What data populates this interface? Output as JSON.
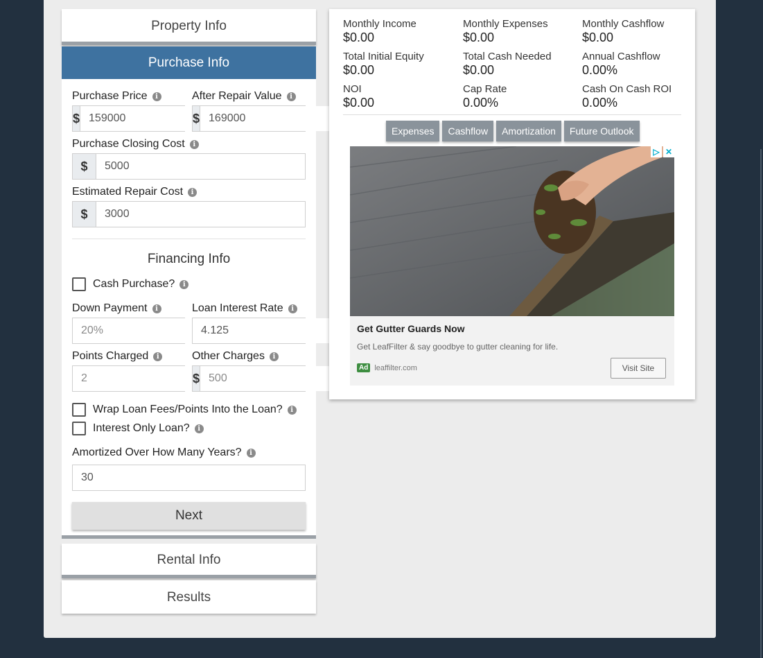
{
  "sections": {
    "property_info": "Property Info",
    "purchase_info": "Purchase Info",
    "rental_info": "Rental Info",
    "results": "Results"
  },
  "purchase": {
    "purchase_price": {
      "label": "Purchase Price",
      "prefix": "$",
      "value": "159000"
    },
    "after_repair_value": {
      "label": "After Repair Value",
      "prefix": "$",
      "value": "169000"
    },
    "closing_cost": {
      "label": "Purchase Closing Cost",
      "prefix": "$",
      "value": "5000"
    },
    "repair_cost": {
      "label": "Estimated Repair Cost",
      "prefix": "$",
      "value": "3000"
    }
  },
  "financing": {
    "title": "Financing Info",
    "cash_purchase": "Cash Purchase?",
    "down_payment": {
      "label": "Down Payment",
      "placeholder": "20%",
      "suffix": "%"
    },
    "interest_rate": {
      "label": "Loan Interest Rate",
      "value": "4.125",
      "suffix": "%"
    },
    "points": {
      "label": "Points Charged",
      "placeholder": "2"
    },
    "other_charges": {
      "label": "Other Charges",
      "prefix": "$",
      "placeholder": "500"
    },
    "wrap_fees": "Wrap Loan Fees/Points Into the Loan?",
    "interest_only": "Interest Only Loan?",
    "amortized": {
      "label": "Amortized Over How Many Years?",
      "value": "30"
    },
    "next": "Next"
  },
  "summary": {
    "monthly_income": {
      "label": "Monthly Income",
      "value": "$0.00"
    },
    "monthly_expenses": {
      "label": "Monthly Expenses",
      "value": "$0.00"
    },
    "monthly_cashflow": {
      "label": "Monthly Cashflow",
      "value": "$0.00"
    },
    "total_equity": {
      "label": "Total Initial Equity",
      "value": "$0.00"
    },
    "total_cash": {
      "label": "Total Cash Needed",
      "value": "$0.00"
    },
    "annual_cashflow": {
      "label": "Annual Cashflow",
      "value": "0.00%"
    },
    "noi": {
      "label": "NOI",
      "value": "$0.00"
    },
    "cap_rate": {
      "label": "Cap Rate",
      "value": "0.00%"
    },
    "coc_roi": {
      "label": "Cash On Cash ROI",
      "value": "0.00%"
    }
  },
  "tabs": [
    "Expenses",
    "Cashflow",
    "Amortization",
    "Future Outlook"
  ],
  "ad": {
    "headline": "Get Gutter Guards Now",
    "description": "Get LeafFilter & say goodbye to gutter cleaning for life.",
    "badge": "Ad",
    "domain": "leaffilter.com",
    "cta": "Visit Site"
  },
  "info_icon": "info-circle-icon",
  "colors": {
    "accent": "#3e72a0",
    "background": "#22303f"
  }
}
